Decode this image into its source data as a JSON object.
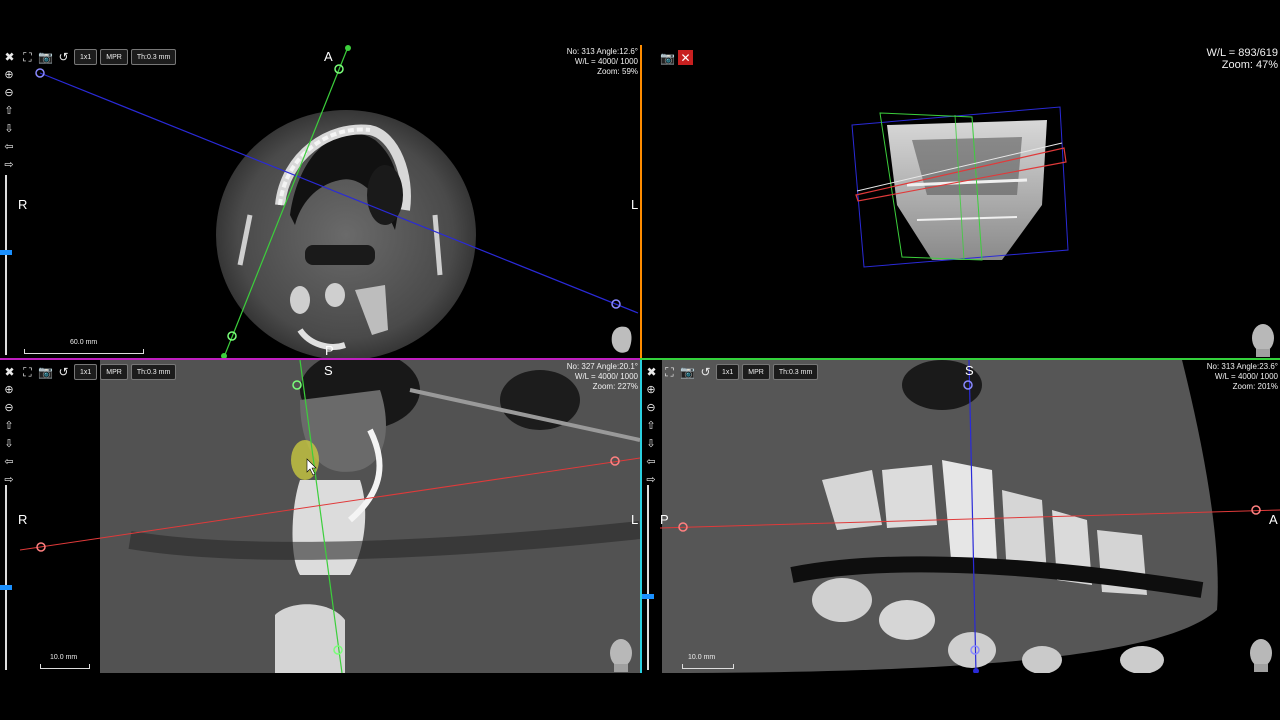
{
  "colors": {
    "axial_border": "#ff8c00",
    "coronal_border": "#2ad0e0",
    "row_divider_left": "#c020c0",
    "row_divider_right": "#34d23c",
    "line_green": "#3ccf3c",
    "line_blue": "#2a2ad8",
    "line_red": "#e03a3a"
  },
  "toolbar": {
    "tools_icon": "crossed-tools-icon",
    "expand_icon": "expand-icon",
    "camera_icon": "camera-icon",
    "reset_icon": "reset-icon",
    "layout_label": "1x1",
    "mpr_label": "MPR",
    "thickness_label": "Th:0.3 mm"
  },
  "side_tools": [
    "zoom-in-icon",
    "zoom-out-icon",
    "arrow-up-icon",
    "arrow-down-icon",
    "arrow-left-icon",
    "arrow-right-icon"
  ],
  "views": {
    "axial": {
      "info": [
        "No: 313 Angle:12.6°",
        "W/L = 4000/ 1000",
        "Zoom: 59%"
      ],
      "orientation": {
        "top": "A",
        "bottom": "P",
        "left": "R",
        "right": "L"
      },
      "scale_label": "60.0 mm"
    },
    "volume": {
      "info": [
        "W/L = 893/619",
        "Zoom: 47%"
      ],
      "camera_icon": "camera-icon",
      "close_icon": "close-icon"
    },
    "coronal": {
      "info": [
        "No: 327 Angle:20.1°",
        "W/L = 4000/ 1000",
        "Zoom: 227%"
      ],
      "orientation": {
        "top": "S",
        "left": "R",
        "right": "L"
      },
      "scale_label": "10.0 mm"
    },
    "sagittal": {
      "info": [
        "No: 313 Angle:23.6°",
        "W/L = 4000/ 1000",
        "Zoom: 201%"
      ],
      "orientation": {
        "top": "S",
        "left": "P",
        "right": "A"
      },
      "scale_label": "10.0 mm"
    }
  }
}
